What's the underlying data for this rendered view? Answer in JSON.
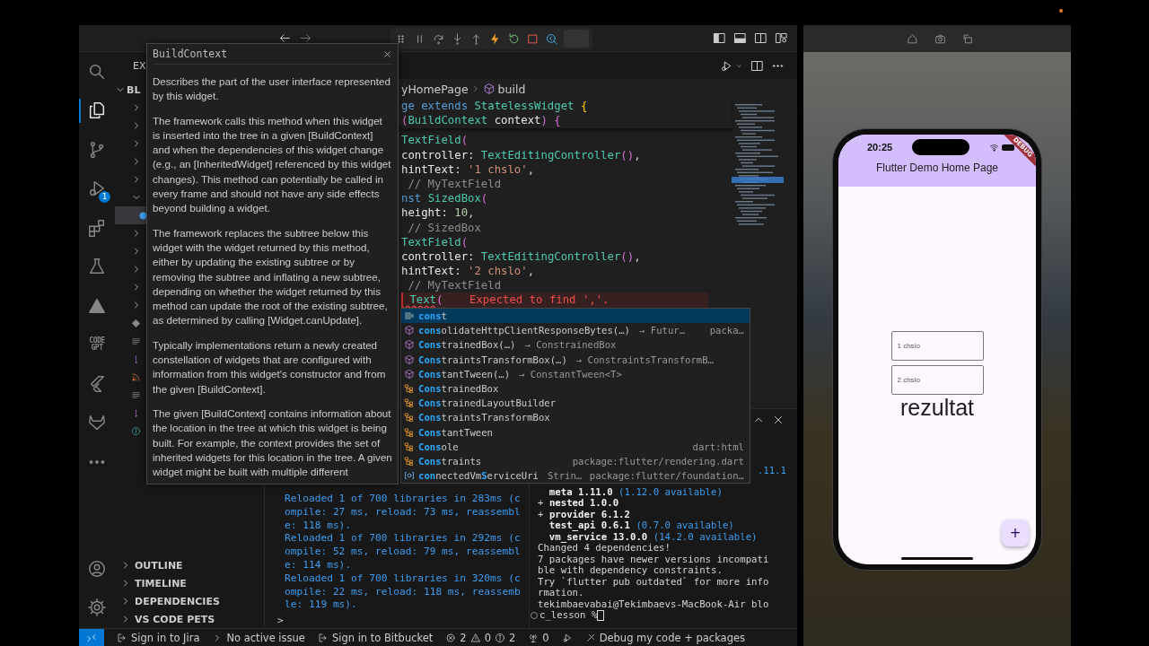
{
  "title_bar": {
    "debug_toolbar": [
      {
        "kind": "grip"
      },
      {
        "kind": "pause"
      },
      {
        "kind": "step-over"
      },
      {
        "kind": "step-into"
      },
      {
        "kind": "step-out"
      },
      {
        "kind": "hot-reload"
      },
      {
        "kind": "restart"
      },
      {
        "kind": "stop"
      },
      {
        "kind": "devtools"
      }
    ]
  },
  "activity_bar": {
    "items": [
      {
        "kind": "search",
        "selected": false
      },
      {
        "kind": "files",
        "selected": true
      },
      {
        "kind": "source-control",
        "selected": false
      },
      {
        "kind": "debug",
        "selected": false,
        "badge": "1"
      },
      {
        "kind": "extensions",
        "selected": false
      },
      {
        "kind": "testing",
        "selected": false
      },
      {
        "kind": "atlassian",
        "selected": false
      },
      {
        "kind": "codegpt",
        "selected": false,
        "label": "CODE GPT"
      },
      {
        "kind": "flutter",
        "selected": false
      },
      {
        "kind": "gitlab",
        "selected": false
      },
      {
        "kind": "more",
        "selected": false
      }
    ],
    "bottom": [
      {
        "kind": "account"
      },
      {
        "kind": "settings"
      }
    ]
  },
  "sidebar": {
    "header": "EX",
    "root": "BL",
    "tree": [
      {
        "kind": "folder",
        "expanded": false
      },
      {
        "kind": "folder",
        "expanded": false
      },
      {
        "kind": "folder",
        "expanded": false
      },
      {
        "kind": "folder",
        "expanded": false
      },
      {
        "kind": "folder",
        "expanded": false
      },
      {
        "kind": "folder",
        "expanded": true,
        "children": [
          {
            "kind": "dart",
            "selected": true
          }
        ]
      },
      {
        "kind": "folder",
        "expanded": false
      },
      {
        "kind": "folder",
        "expanded": false
      },
      {
        "kind": "folder",
        "expanded": false
      },
      {
        "kind": "folder",
        "expanded": false
      },
      {
        "kind": "folder",
        "expanded": false
      },
      {
        "kind": "git"
      },
      {
        "kind": "lines"
      },
      {
        "kind": "yaml"
      },
      {
        "kind": "rss"
      },
      {
        "kind": "lines"
      },
      {
        "kind": "yaml"
      },
      {
        "kind": "info"
      }
    ],
    "sections": [
      "OUTLINE",
      "TIMELINE",
      "DEPENDENCIES",
      "VS CODE PETS"
    ]
  },
  "editor": {
    "breadcrumb": [
      "yHomePage",
      "build"
    ],
    "sticky_lines": [
      {
        "tokens": [
          {
            "kind": "kw",
            "text": "ge extends "
          },
          {
            "kind": "type",
            "text": "StatelessWidget "
          },
          {
            "kind": "brace",
            "text": "{"
          }
        ]
      },
      {
        "tokens": [
          {
            "kind": "paren",
            "text": "("
          },
          {
            "kind": "type",
            "text": "BuildContext "
          },
          {
            "kind": "var",
            "text": "context"
          },
          {
            "kind": "paren",
            "text": ") {"
          }
        ]
      }
    ],
    "lines": [
      {
        "kind": "code",
        "tokens": [
          {
            "kind": "type",
            "text": "TextField"
          },
          {
            "kind": "paren",
            "text": "("
          }
        ]
      },
      {
        "kind": "code",
        "tokens": [
          {
            "kind": "var",
            "text": "controller: "
          },
          {
            "kind": "type",
            "text": "TextEditingController"
          },
          {
            "kind": "paren",
            "text": "()"
          },
          {
            "kind": "plain",
            "text": ","
          }
        ]
      },
      {
        "kind": "code",
        "tokens": [
          {
            "kind": "var",
            "text": "hintText: "
          },
          {
            "kind": "str",
            "text": "'1 chslo'"
          },
          {
            "kind": "plain",
            "text": ","
          }
        ]
      },
      {
        "kind": "code",
        "tokens": [
          {
            "kind": "comment",
            "text": " // MyTextField"
          }
        ]
      },
      {
        "kind": "code",
        "tokens": [
          {
            "kind": "kw",
            "text": "nst "
          },
          {
            "kind": "type",
            "text": "SizedBox"
          },
          {
            "kind": "paren",
            "text": "("
          }
        ]
      },
      {
        "kind": "code",
        "tokens": [
          {
            "kind": "var",
            "text": "height: "
          },
          {
            "kind": "num",
            "text": "10"
          },
          {
            "kind": "plain",
            "text": ","
          }
        ]
      },
      {
        "kind": "code",
        "tokens": [
          {
            "kind": "comment",
            "text": " // SizedBox"
          }
        ]
      },
      {
        "kind": "code",
        "tokens": [
          {
            "kind": "type",
            "text": "TextField"
          },
          {
            "kind": "paren",
            "text": "("
          }
        ]
      },
      {
        "kind": "code",
        "tokens": [
          {
            "kind": "var",
            "text": "controller: "
          },
          {
            "kind": "type",
            "text": "TextEditingController"
          },
          {
            "kind": "paren",
            "text": "()"
          },
          {
            "kind": "plain",
            "text": ","
          }
        ]
      },
      {
        "kind": "code",
        "tokens": [
          {
            "kind": "var",
            "text": "hintText: "
          },
          {
            "kind": "str",
            "text": "'2 chslo'"
          },
          {
            "kind": "plain",
            "text": ","
          }
        ]
      },
      {
        "kind": "code",
        "tokens": [
          {
            "kind": "comment",
            "text": " // MyTextField"
          }
        ]
      },
      {
        "kind": "error",
        "tokens": [
          {
            "kind": "type",
            "text": " Text"
          },
          {
            "kind": "paren",
            "text": "("
          },
          {
            "kind": "err",
            "text": "    Expected to find ','."
          }
        ]
      }
    ]
  },
  "hover": {
    "title": "BuildContext",
    "paragraphs": [
      "Describes the part of the user interface represented by this widget.",
      "The framework calls this method when this widget is inserted into the tree in a given [BuildContext] and when the dependencies of this widget change (e.g., an [InheritedWidget] referenced by this widget changes). This method can potentially be called in every frame and should not have any side effects beyond building a widget.",
      "The framework replaces the subtree below this widget with the widget returned by this method, either by updating the existing subtree or by removing the subtree and inflating a new subtree, depending on whether the widget returned by this method can update the root of the existing subtree, as determined by calling [Widget.canUpdate].",
      "Typically implementations return a newly created constellation of widgets that are configured with information from this widget's constructor and from the given [BuildContext].",
      "The given [BuildContext] contains information about the location in the tree at which this widget is being built. For example, the context provides the set of inherited widgets for this location in the tree. A given widget might be built with multiple different"
    ]
  },
  "suggestions": [
    {
      "kind": "keyword",
      "selected": true,
      "label": "**cons**t"
    },
    {
      "kind": "method",
      "selected": false,
      "label": "**cons**olidateHttpClientResponseBytes(…)",
      "detail": "→ Futur…",
      "source": "packa…"
    },
    {
      "kind": "method",
      "selected": false,
      "label": "**Cons**trainedBox(…)",
      "detail": "→ ConstrainedBox"
    },
    {
      "kind": "method",
      "selected": false,
      "label": "**Cons**traintsTransformBox(…)",
      "detail": "→ ConstraintsTransformB…"
    },
    {
      "kind": "method",
      "selected": false,
      "label": "**Cons**tantTween(…)",
      "detail": "→ ConstantTween<T>"
    },
    {
      "kind": "class",
      "selected": false,
      "label": "**Cons**trainedBox"
    },
    {
      "kind": "class",
      "selected": false,
      "label": "**Cons**trainedLayoutBuilder"
    },
    {
      "kind": "class",
      "selected": false,
      "label": "**Cons**traintsTransformBox"
    },
    {
      "kind": "class",
      "selected": false,
      "label": "**Cons**tantTween"
    },
    {
      "kind": "class",
      "selected": false,
      "label": "**Cons**ole",
      "source": "dart:html"
    },
    {
      "kind": "class",
      "selected": false,
      "label": "**Cons**traints",
      "source": "package:flutter/rendering.dart"
    },
    {
      "kind": "field",
      "selected": false,
      "label": "**con**nectedVm**S**erviceUri",
      "detail": "Strin…",
      "source": "package:flutter/foundation…"
    }
  ],
  "debug_console": {
    "lines": [
      "Reloaded 1 of 700 libraries in 283ms (c",
      "ompile: 27 ms, reload: 73 ms, reassembl",
      "e: 118 ms).",
      "Reloaded 1 of 700 libraries in 292ms (c",
      "ompile: 52 ms, reload: 79 ms, reassembl",
      "e: 114 ms).",
      "Reloaded 1 of 700 libraries in 320ms (c",
      "ompile: 22 ms, reload: 118 ms, reassemb",
      "le: 119 ms)."
    ],
    "prompt": ">"
  },
  "terminal": {
    "lines": [
      {
        "kind": "tail",
        "tokens": [
          {
            "kind": "info",
            "text": ".11.1"
          }
        ]
      },
      {
        "kind": "line",
        "tokens": [
          {
            "kind": "bold",
            "text": "  meta 1.11.0"
          },
          {
            "kind": "info",
            "text": " (1.12.0 available)"
          }
        ]
      },
      {
        "kind": "line",
        "tokens": [
          {
            "kind": "plain",
            "text": "+ "
          },
          {
            "kind": "bold",
            "text": "nested 1.0.0"
          }
        ]
      },
      {
        "kind": "line",
        "tokens": [
          {
            "kind": "plain",
            "text": "+ "
          },
          {
            "kind": "bold",
            "text": "provider 6.1.2"
          }
        ]
      },
      {
        "kind": "line",
        "tokens": [
          {
            "kind": "bold",
            "text": "  test_api 0.6.1"
          },
          {
            "kind": "info",
            "text": " (0.7.0 available)"
          }
        ]
      },
      {
        "kind": "line",
        "tokens": [
          {
            "kind": "bold",
            "text": "  vm_service 13.0.0"
          },
          {
            "kind": "info",
            "text": " (14.2.0 available)"
          }
        ]
      },
      {
        "kind": "line",
        "tokens": [
          {
            "kind": "plain",
            "text": "Changed 4 dependencies!"
          }
        ]
      },
      {
        "kind": "line",
        "tokens": [
          {
            "kind": "plain",
            "text": "7 packages have newer versions incompati"
          }
        ]
      },
      {
        "kind": "line",
        "tokens": [
          {
            "kind": "plain",
            "text": "ble with dependency constraints."
          }
        ]
      },
      {
        "kind": "line",
        "tokens": [
          {
            "kind": "plain",
            "text": "Try `flutter pub outdated` for more info"
          }
        ]
      },
      {
        "kind": "line",
        "tokens": [
          {
            "kind": "plain",
            "text": "rmation."
          }
        ]
      },
      {
        "kind": "line",
        "tokens": [
          {
            "kind": "plain",
            "text": "tekimbaevabai@Tekimbaevs-MacBook-Air blo"
          }
        ]
      },
      {
        "kind": "prompt",
        "tokens": [
          {
            "kind": "plain",
            "text": "c_lesson %"
          }
        ]
      }
    ]
  },
  "status_bar": [
    {
      "kind": "remote"
    },
    {
      "kind": "signin",
      "label": "Sign in to Jira"
    },
    {
      "kind": "issue",
      "label": "No active issue"
    },
    {
      "kind": "signin",
      "label": "Sign in to Bitbucket"
    },
    {
      "kind": "problems",
      "errors": "2",
      "warnings": "0",
      "infos": "2"
    },
    {
      "kind": "ports",
      "label": "0"
    },
    {
      "kind": "debug"
    },
    {
      "kind": "flutter-debug",
      "label": "Debug my code + packages"
    }
  ],
  "simulator": {
    "toolbar": [
      {
        "kind": "home"
      },
      {
        "kind": "screenshot"
      },
      {
        "kind": "rotate"
      }
    ],
    "phone": {
      "time": "20:25",
      "banner": "DEBUG",
      "app_title": "Flutter Demo Home Page",
      "fields": [
        {
          "placeholder": "1 chslo"
        },
        {
          "placeholder": "2 chslo"
        }
      ],
      "result": "rezultat",
      "fab": "+"
    }
  }
}
